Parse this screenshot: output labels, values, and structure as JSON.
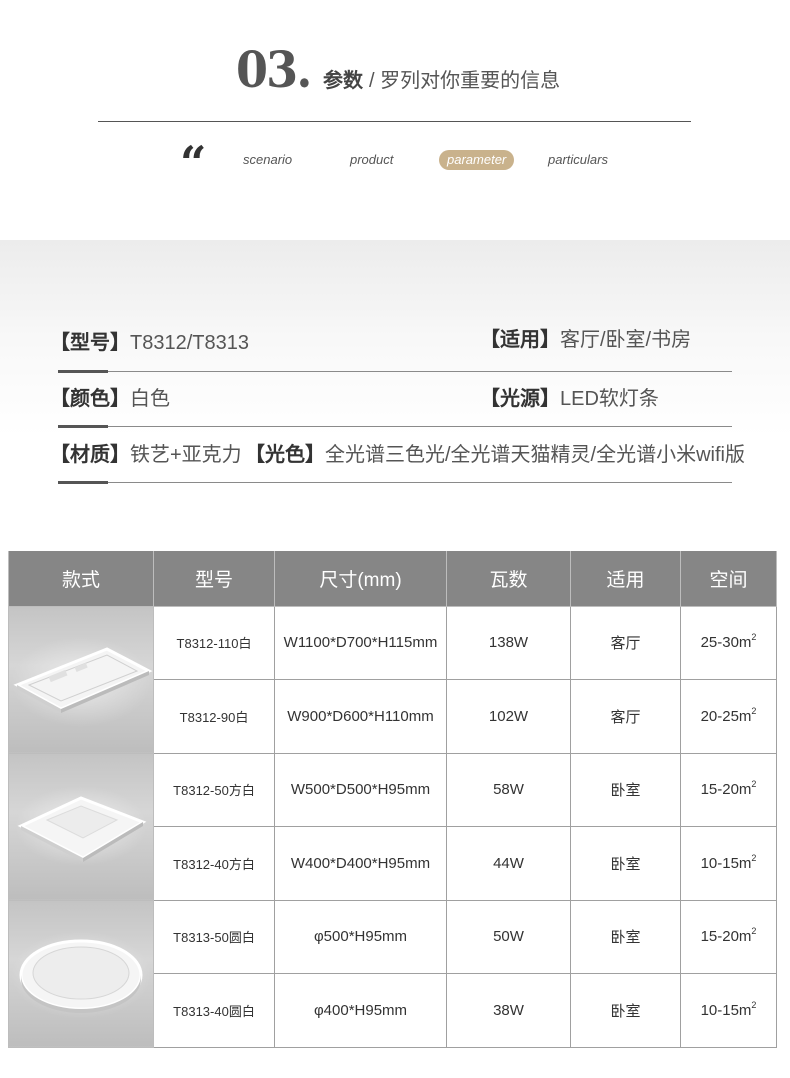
{
  "header": {
    "number": "03.",
    "title": "参数",
    "subtitle": "/ 罗列对你重要的信息",
    "quote_icon": "quote-icon",
    "nav": [
      {
        "label": "scenario"
      },
      {
        "label": "product"
      },
      {
        "label": "parameter",
        "active": true
      },
      {
        "label": "particulars"
      }
    ],
    "accent_color": "#c9b28c"
  },
  "params": {
    "model_key": "【型号】",
    "model_value": "T8312/T8313",
    "use_key": "【适用】",
    "use_value": "客厅/卧室/书房",
    "color_key": "【颜色】",
    "color_value": "白色",
    "light_source_key": "【光源】",
    "light_source_value": "LED软灯条",
    "material_key": "【材质】",
    "material_value": "铁艺+亚克力",
    "light_color_key": "【光色】",
    "light_color_value": "全光谱三色光/全光谱天猫精灵/全光谱小米wifi版"
  },
  "table": {
    "headers": [
      "款式",
      "型号",
      "尺寸(mm)",
      "瓦数",
      "适用",
      "空间"
    ],
    "rows": [
      {
        "model": "T8312-110白",
        "size": "W1100*D700*H115mm",
        "watt": "138W",
        "use": "客厅",
        "space": "25-30m",
        "unit_sup": "2"
      },
      {
        "model": "T8312-90白",
        "size": "W900*D600*H110mm",
        "watt": "102W",
        "use": "客厅",
        "space": "20-25m",
        "unit_sup": "2"
      },
      {
        "model": "T8312-50方白",
        "size": "W500*D500*H95mm",
        "watt": "58W",
        "use": "卧室",
        "space": "15-20m",
        "unit_sup": "2"
      },
      {
        "model": "T8312-40方白",
        "size": "W400*D400*H95mm",
        "watt": "44W",
        "use": "卧室",
        "space": "10-15m",
        "unit_sup": "2"
      },
      {
        "model": "T8313-50圆白",
        "size": "φ500*H95mm",
        "watt": "50W",
        "use": "卧室",
        "space": "15-20m",
        "unit_sup": "2"
      },
      {
        "model": "T8313-40圆白",
        "size": "φ400*H95mm",
        "watt": "38W",
        "use": "卧室",
        "space": "10-15m",
        "unit_sup": "2"
      }
    ]
  }
}
